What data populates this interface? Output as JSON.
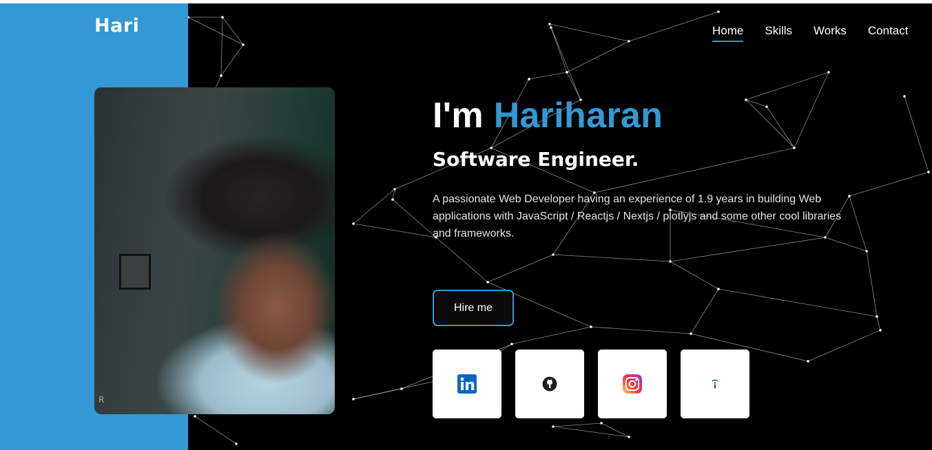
{
  "logo": "Hari",
  "nav": {
    "items": [
      {
        "label": "Home",
        "active": true
      },
      {
        "label": "Skills",
        "active": false
      },
      {
        "label": "Works",
        "active": false
      },
      {
        "label": "Contact",
        "active": false
      }
    ]
  },
  "hero": {
    "intro": "I'm",
    "name": "Hariharan",
    "subtitle": "Software Engineer.",
    "description": "A passionate Web Developer having an experience of 1.9 years in building Web applications with JavaScript / Reactjs / Nextjs / plotlyjs and some other cool libraries and frameworks.",
    "hire_label": "Hire me"
  },
  "photo_watermark": "R",
  "socials": [
    {
      "icon": "linkedin-icon"
    },
    {
      "icon": "github-icon"
    },
    {
      "icon": "instagram-icon"
    },
    {
      "icon": "info-icon"
    }
  ],
  "colors": {
    "accent": "#3398d3",
    "background": "#000000",
    "text": "#ffffff"
  }
}
